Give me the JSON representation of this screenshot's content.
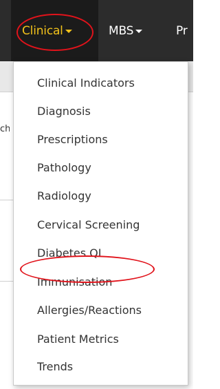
{
  "navbar": {
    "items": [
      {
        "label": "Clinical",
        "active": true
      },
      {
        "label": "MBS"
      },
      {
        "label": "Pr"
      }
    ]
  },
  "background": {
    "fragment_text": "ch"
  },
  "dropdown": {
    "items": [
      {
        "label": "Clinical Indicators"
      },
      {
        "label": "Diagnosis"
      },
      {
        "label": "Prescriptions"
      },
      {
        "label": "Pathology"
      },
      {
        "label": "Radiology"
      },
      {
        "label": "Cervical Screening"
      },
      {
        "label": "Diabetes QI"
      },
      {
        "label": "Immunisation",
        "highlighted": true
      },
      {
        "label": "Allergies/Reactions"
      },
      {
        "label": "Patient Metrics"
      },
      {
        "label": "Trends"
      }
    ]
  },
  "colors": {
    "navbar_bg": "#2c2c2c",
    "active_nav_text": "#f2c21b",
    "highlight_oval": "#e1131b",
    "menu_text": "#333333"
  }
}
